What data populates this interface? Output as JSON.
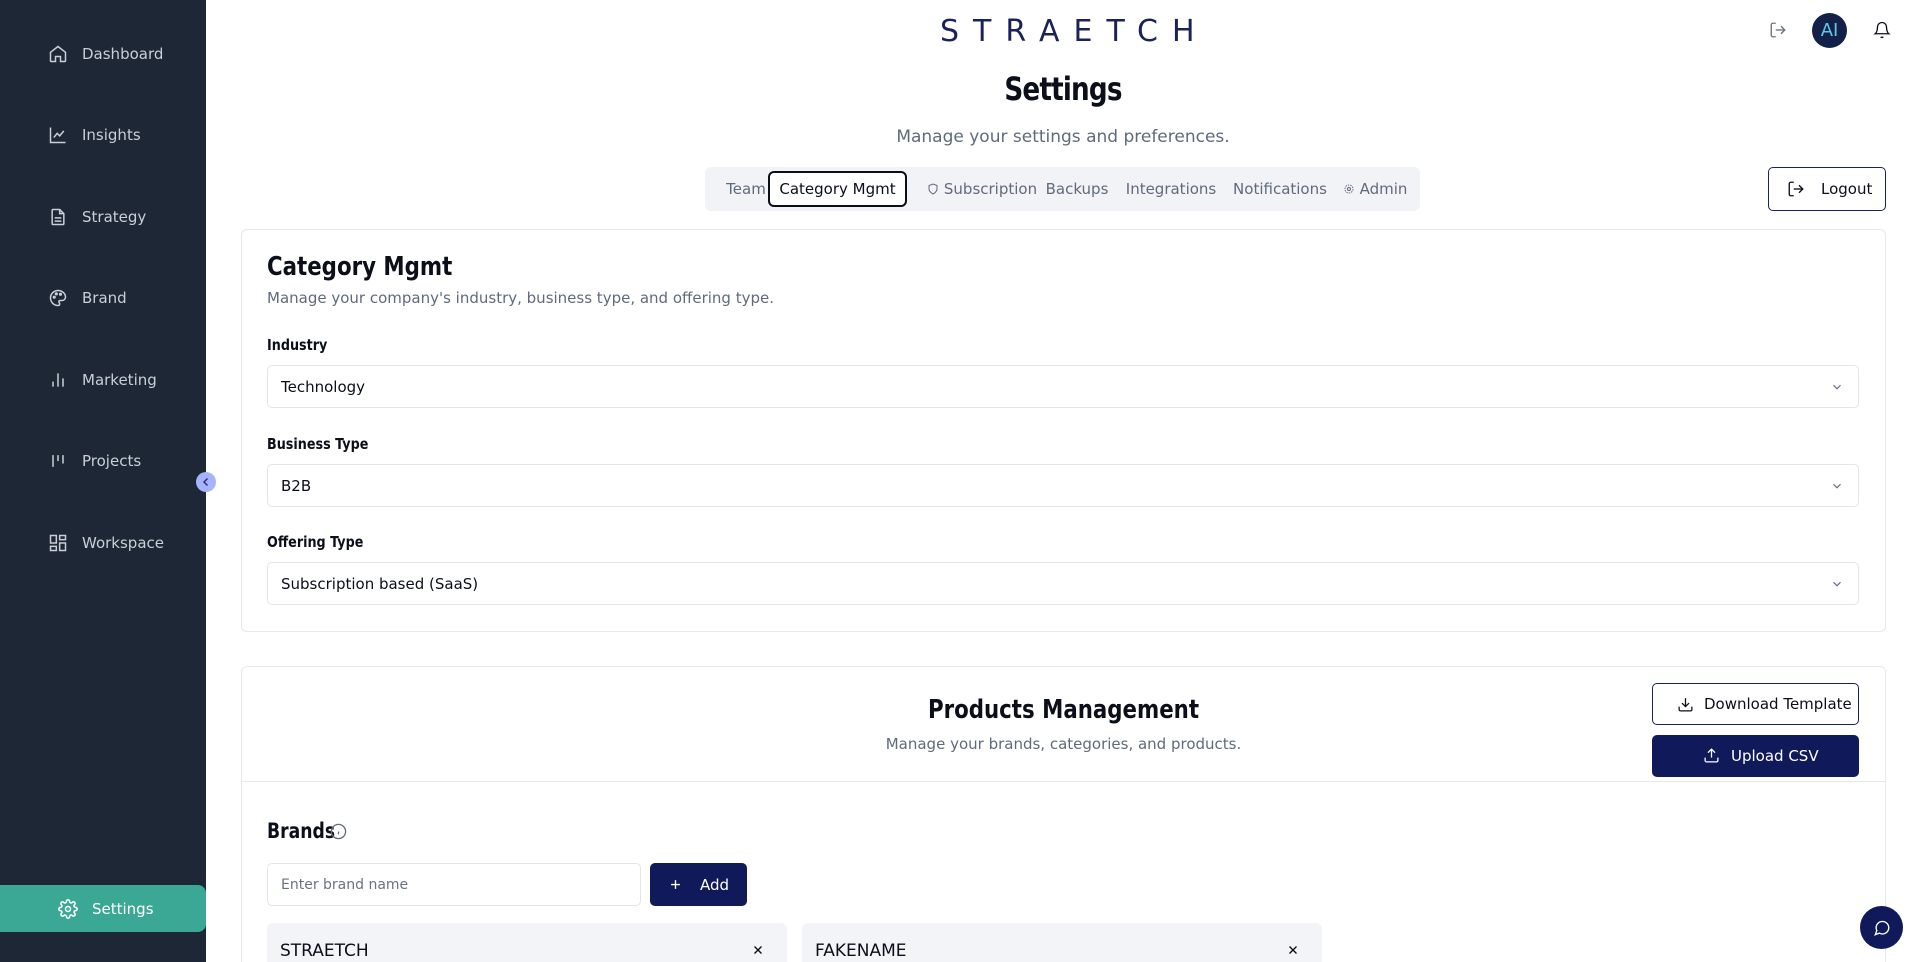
{
  "sidebar": {
    "items": [
      {
        "label": "Dashboard",
        "icon": "home-icon"
      },
      {
        "label": "Insights",
        "icon": "line-chart-icon"
      },
      {
        "label": "Strategy",
        "icon": "document-icon"
      },
      {
        "label": "Brand",
        "icon": "palette-icon"
      },
      {
        "label": "Marketing",
        "icon": "bar-chart-icon"
      },
      {
        "label": "Projects",
        "icon": "kanban-icon"
      },
      {
        "label": "Workspace",
        "icon": "grid-icon"
      }
    ],
    "active": {
      "label": "Settings",
      "icon": "gear-icon"
    },
    "active_color": "#3ba896",
    "background": "#1e2735"
  },
  "header": {
    "logo": "STRAETCH",
    "avatar_text": "AI"
  },
  "page": {
    "title": "Settings",
    "subtitle": "Manage your settings and preferences."
  },
  "tabs": [
    {
      "label": "Team",
      "active": false
    },
    {
      "label": "Category Mgmt",
      "active": true
    },
    {
      "label": "Subscription",
      "active": false,
      "icon": "shield-icon"
    },
    {
      "label": "Backups",
      "active": false
    },
    {
      "label": "Integrations",
      "active": false
    },
    {
      "label": "Notifications",
      "active": false
    },
    {
      "label": "Admin",
      "active": false,
      "icon": "gear-icon"
    }
  ],
  "logout_label": "Logout",
  "category": {
    "title": "Category Mgmt",
    "subtitle": "Manage your company's industry, business type, and offering type.",
    "industry": {
      "label": "Industry",
      "value": "Technology"
    },
    "business_type": {
      "label": "Business Type",
      "value": "B2B"
    },
    "offering_type": {
      "label": "Offering Type",
      "value": "Subscription based (SaaS)"
    }
  },
  "products": {
    "title": "Products Management",
    "subtitle": "Manage your brands, categories, and products.",
    "download_label": "Download Template",
    "upload_label": "Upload CSV",
    "brands_title": "Brands",
    "brand_placeholder": "Enter brand name",
    "add_label": "Add",
    "brands": [
      "STRAETCH",
      "FAKENAME"
    ]
  },
  "colors": {
    "primary": "#101a5a",
    "accent": "#3ba896",
    "muted_text": "#5f6b7c"
  }
}
